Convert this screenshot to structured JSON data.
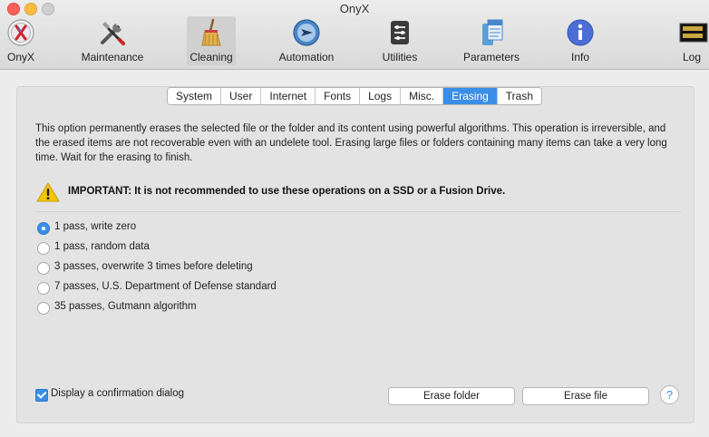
{
  "window": {
    "title": "OnyX"
  },
  "toolbar": {
    "items": [
      {
        "label": "OnyX",
        "icon": "onyx-icon"
      },
      {
        "label": "Maintenance",
        "icon": "tools-icon"
      },
      {
        "label": "Cleaning",
        "icon": "broom-icon"
      },
      {
        "label": "Automation",
        "icon": "automation-icon"
      },
      {
        "label": "Utilities",
        "icon": "utilities-icon"
      },
      {
        "label": "Parameters",
        "icon": "parameters-icon"
      },
      {
        "label": "Info",
        "icon": "info-icon"
      },
      {
        "label": "Log",
        "icon": "log-icon"
      }
    ],
    "active": "Cleaning",
    "log_icon_text": "WARNIN 9:7:06"
  },
  "tabs": {
    "items": [
      "System",
      "User",
      "Internet",
      "Fonts",
      "Logs",
      "Misc.",
      "Erasing",
      "Trash"
    ],
    "selected": "Erasing"
  },
  "erasing": {
    "description": "This option permanently erases the selected file or the folder and its content using powerful algorithms. This operation is irreversible, and the erased items are not recoverable even with an undelete tool. Erasing large files or folders containing many items can take a very long time. Wait for the erasing to finish.",
    "warning": "IMPORTANT: It is not recommended to use these operations on a SSD or a Fusion Drive.",
    "options": [
      {
        "label": "1 pass, write zero",
        "selected": true
      },
      {
        "label": "1 pass, random data",
        "selected": false
      },
      {
        "label": "3 passes, overwrite 3 times before deleting",
        "selected": false
      },
      {
        "label": "7 passes, U.S. Department of Defense standard",
        "selected": false
      },
      {
        "label": "35 passes, Gutmann algorithm",
        "selected": false
      }
    ],
    "confirm_label": "Display a confirmation dialog",
    "confirm_checked": true,
    "erase_folder_label": "Erase folder",
    "erase_file_label": "Erase file",
    "help_label": "?"
  },
  "colors": {
    "accent": "#3a8ee6",
    "warning": "#f5c400"
  }
}
